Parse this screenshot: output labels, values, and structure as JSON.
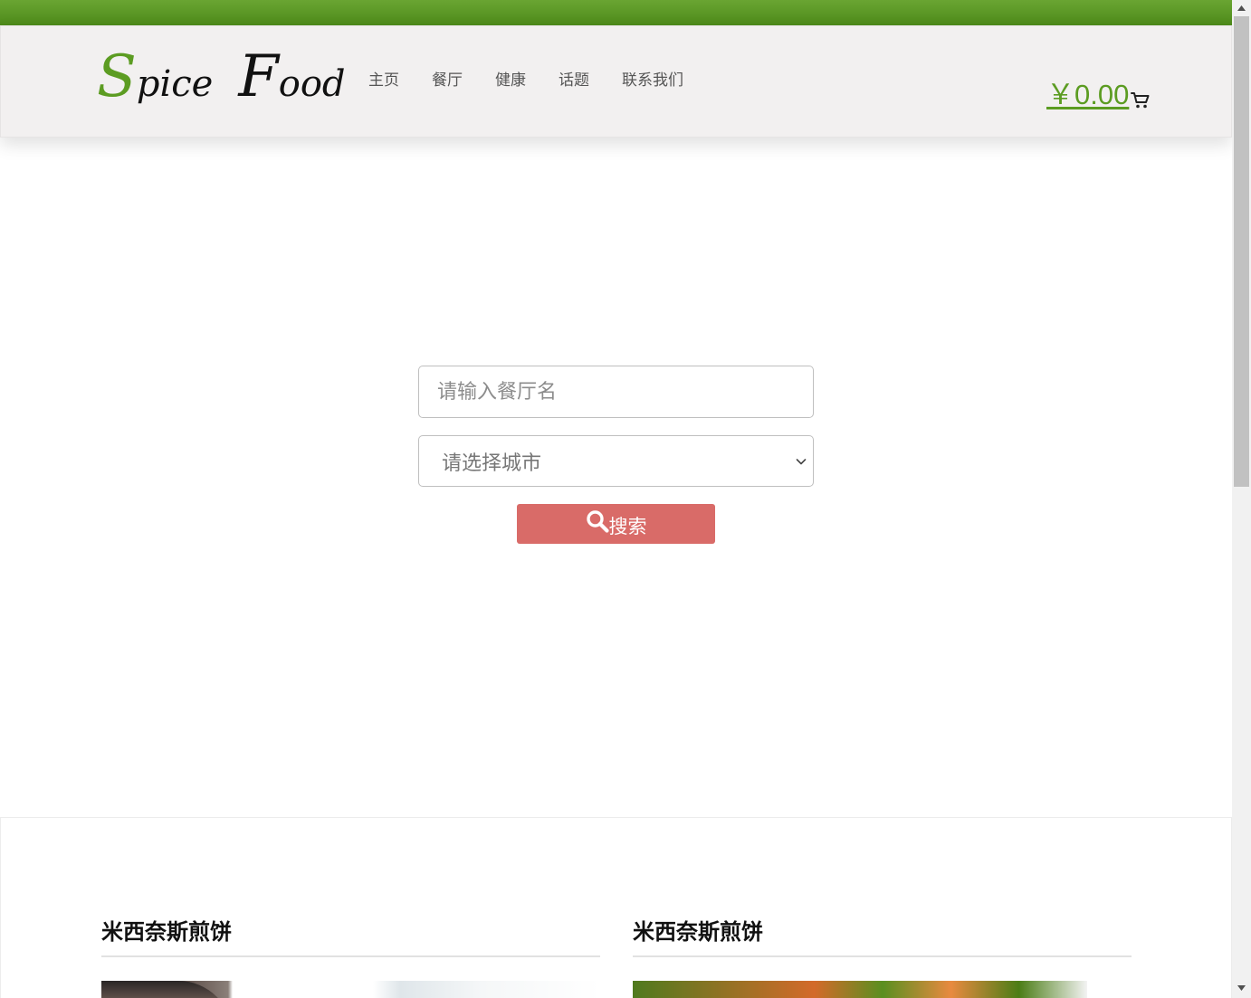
{
  "brand": {
    "logo_word1_cap": "S",
    "logo_word1_rest": "pice",
    "logo_word2_cap": "F",
    "logo_word2_rest": "ood",
    "accent_color": "#5c9c22"
  },
  "nav": {
    "items": [
      {
        "label": "主页"
      },
      {
        "label": "餐厅"
      },
      {
        "label": "健康"
      },
      {
        "label": "话题"
      },
      {
        "label": "联系我们"
      }
    ]
  },
  "cart": {
    "price": "￥0.00",
    "icon": "cart-icon"
  },
  "search": {
    "placeholder": "请输入餐厅名",
    "city_select_value": "请选择城市",
    "button_label": "搜索",
    "button_color": "#d96b68"
  },
  "cards": [
    {
      "title": "米西奈斯煎饼"
    },
    {
      "title": "米西奈斯煎饼"
    }
  ]
}
